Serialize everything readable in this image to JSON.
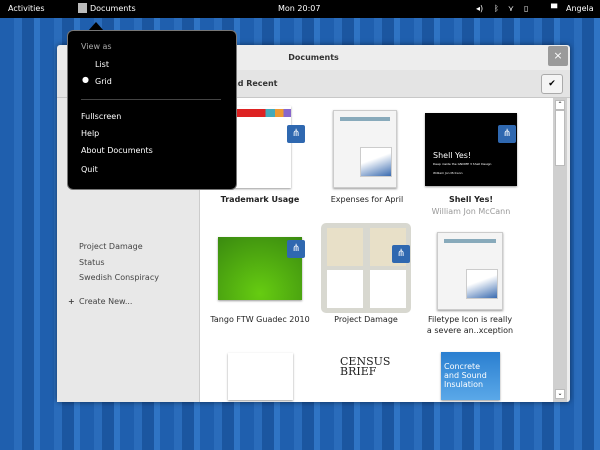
{
  "topbar": {
    "activities": "Activities",
    "app": "Documents",
    "clock": "Mon 20:07",
    "user": "Angela"
  },
  "window": {
    "title": "Documents",
    "close": "×",
    "toolbar_label": "nd Recent",
    "check": "✔"
  },
  "sidebar": {
    "items": [
      "Project Damage",
      "Status",
      "Swedish Conspiracy"
    ],
    "create": "Create New..."
  },
  "menu": {
    "heading": "View as",
    "view_options": [
      "List",
      "Grid"
    ],
    "selected": "Grid",
    "items": [
      "Fullscreen",
      "Help",
      "About Documents",
      "Quit"
    ]
  },
  "documents": [
    {
      "title": "Trademark Usage",
      "shared": true
    },
    {
      "title": "Expenses for April"
    },
    {
      "title": "Shell Yes!",
      "author": "William Jon McCann",
      "shared": true,
      "thumb_title": "Shell Yes!",
      "thumb_sub": "Deep inside the GNOME 3 Shell Design",
      "thumb_author": "William Jon McCann"
    },
    {
      "title": "Tango FTW Guadec 2010",
      "shared": true
    },
    {
      "title": "Project Damage",
      "shared": true
    },
    {
      "title": "Filetype Icon is really",
      "title2": "a severe an..xception"
    },
    {
      "title": ""
    },
    {
      "title": "",
      "thumb_title": "CENSUS",
      "thumb_title2": "BRIEF"
    },
    {
      "title": "",
      "thumb_title": "Concrete",
      "thumb_title2": "and Sound",
      "thumb_title3": "Insulation"
    }
  ],
  "colors": {
    "accent": "#2f68b0",
    "topbar": "#000000"
  }
}
